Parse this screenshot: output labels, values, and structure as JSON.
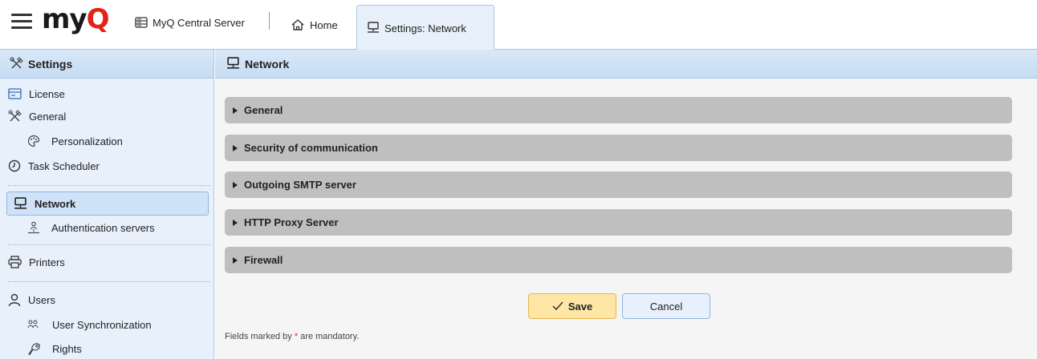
{
  "app": {
    "logo_main": "my",
    "logo_accent": "Q",
    "server_label": "MyQ Central Server"
  },
  "tabs": [
    {
      "label": "Home",
      "icon": "home-icon",
      "active": false
    },
    {
      "label": "Settings: Network",
      "icon": "network-icon",
      "active": true
    }
  ],
  "sidebar": {
    "title": "Settings",
    "items": [
      {
        "label": "License",
        "icon": "license-icon"
      },
      {
        "label": "General",
        "icon": "tools-icon"
      },
      {
        "label": "Personalization",
        "icon": "palette-icon"
      },
      {
        "label": "Task Scheduler",
        "icon": "clock-icon"
      },
      {
        "label": "Network",
        "icon": "network-icon",
        "active": true
      },
      {
        "label": "Authentication servers",
        "icon": "auth-server-icon"
      },
      {
        "label": "Printers",
        "icon": "printer-icon"
      },
      {
        "label": "Users",
        "icon": "user-icon"
      },
      {
        "label": "User Synchronization",
        "icon": "user-sync-icon"
      },
      {
        "label": "Rights",
        "icon": "rights-icon"
      }
    ]
  },
  "main": {
    "title": "Network",
    "sections": [
      {
        "label": "General"
      },
      {
        "label": "Security of communication"
      },
      {
        "label": "Outgoing SMTP server"
      },
      {
        "label": "HTTP Proxy Server"
      },
      {
        "label": "Firewall"
      }
    ],
    "save_label": "Save",
    "cancel_label": "Cancel",
    "note_prefix": "Fields marked by",
    "note_star": "*",
    "note_suffix": "are mandatory."
  },
  "colors": {
    "brand_red": "#e2231a",
    "panel_blue": "#e7f0fb",
    "section_gray": "#bfbfbf",
    "save_yellow": "#fde6a6"
  }
}
